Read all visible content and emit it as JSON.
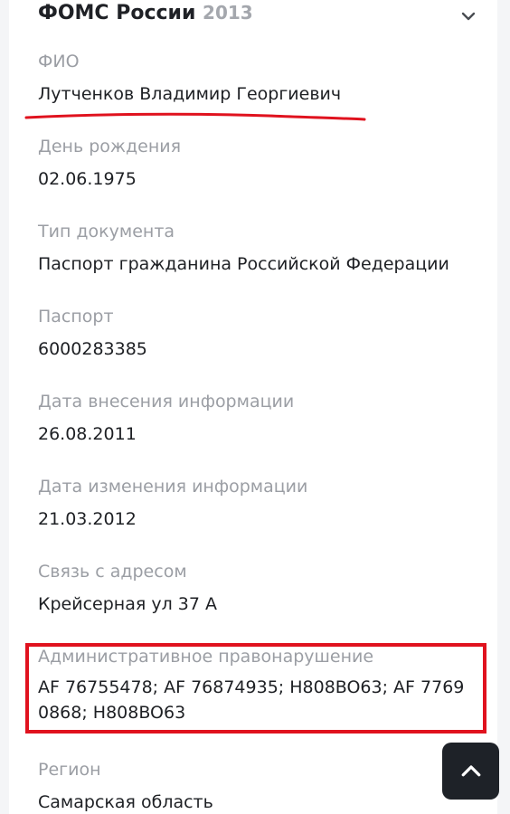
{
  "header": {
    "title": "ФОМС России",
    "year": "2013",
    "collapse_icon": "chevron-down-icon"
  },
  "fields": [
    {
      "label": "ФИО",
      "value": "Лутченков Владимир Георгиевич"
    },
    {
      "label": "День рождения",
      "value": "02.06.1975"
    },
    {
      "label": "Тип документа",
      "value": "Паспорт гражданина Российской Федерации"
    },
    {
      "label": "Паспорт",
      "value": "6000283385"
    },
    {
      "label": "Дата внесения информации",
      "value": "26.08.2011"
    },
    {
      "label": "Дата изменения информации",
      "value": "21.03.2012"
    },
    {
      "label": "Связь с адресом",
      "value": "Крейсерная ул 37 А"
    },
    {
      "label": "Административное правонарушение",
      "value": "AF 76755478; AF 76874935; H808BO63; AF 7769 0868; H808BO63"
    },
    {
      "label": "Регион",
      "value": "Самарская область"
    }
  ],
  "scroll_top": {
    "icon": "chevron-up-icon"
  },
  "colors": {
    "annotation_red": "#e0121e",
    "label_gray": "#9b9ea4",
    "text_dark": "#1e2024",
    "button_dark": "#1e2228"
  }
}
